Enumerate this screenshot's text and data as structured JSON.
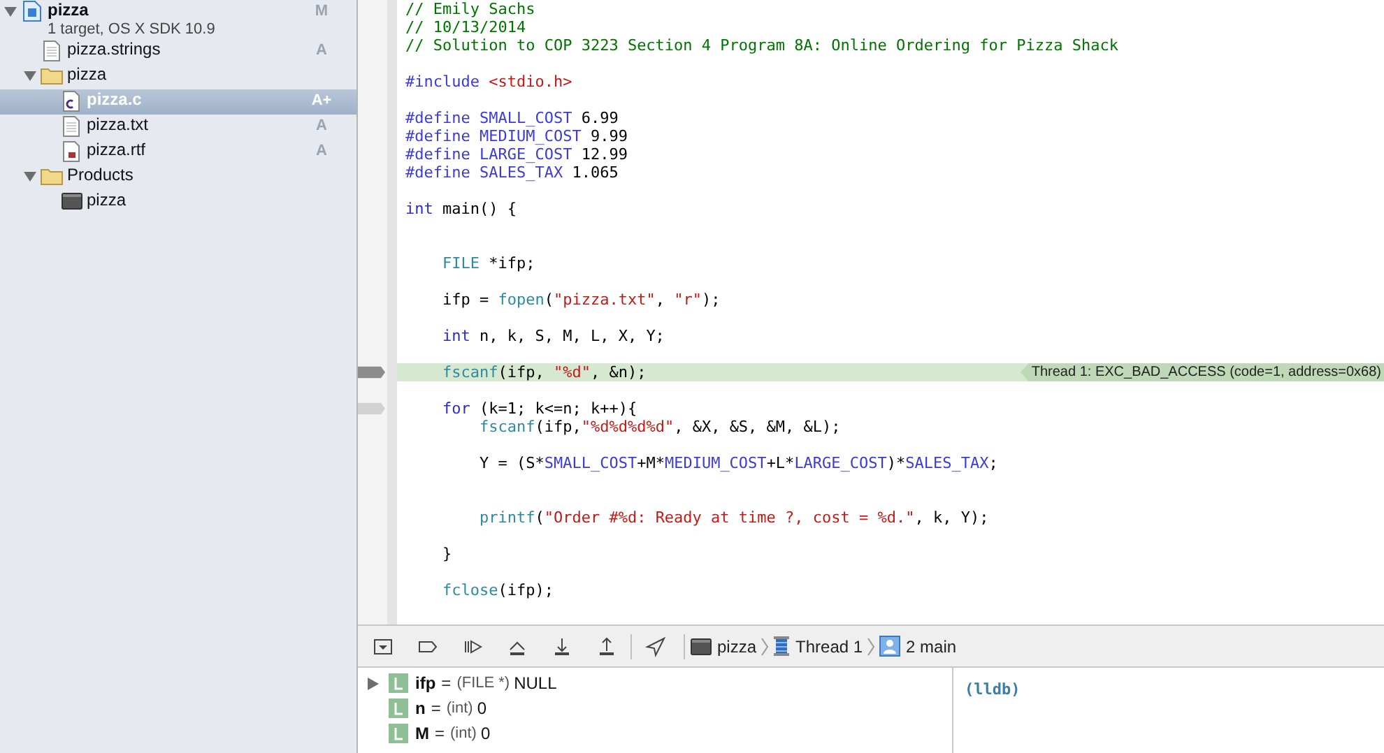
{
  "navigator": {
    "items": [
      {
        "kind": "project",
        "label": "pizza",
        "subtitle": "1 target, OS X SDK 10.9",
        "badge": "M",
        "expanded": true,
        "selected": false,
        "children": [
          {
            "kind": "strings",
            "label": "pizza.strings",
            "badge": "A",
            "selected": false
          },
          {
            "kind": "folder",
            "label": "pizza",
            "expanded": true,
            "selected": false,
            "children": [
              {
                "kind": "c",
                "label": "pizza.c",
                "badge": "A+",
                "selected": true
              },
              {
                "kind": "text",
                "label": "pizza.txt",
                "badge": "A",
                "selected": false
              },
              {
                "kind": "rtf",
                "label": "pizza.rtf",
                "badge": "A",
                "selected": false
              }
            ]
          },
          {
            "kind": "folder",
            "label": "Products",
            "expanded": true,
            "selected": false,
            "children": [
              {
                "kind": "app",
                "label": "pizza",
                "selected": false
              }
            ]
          }
        ]
      }
    ]
  },
  "editor": {
    "lines": [
      {
        "kind": "code",
        "tokens": [
          {
            "text": "// Emily Sachs",
            "kind": "comment"
          }
        ]
      },
      {
        "kind": "code",
        "tokens": [
          {
            "text": "// 10/13/2014",
            "kind": "comment"
          }
        ]
      },
      {
        "kind": "code",
        "tokens": [
          {
            "text": "// Solution to COP 3223 Section 4 Program 8A: Online Ordering for Pizza Shack",
            "kind": "comment"
          }
        ]
      },
      {
        "kind": "blank"
      },
      {
        "kind": "code",
        "tokens": [
          {
            "text": "#include ",
            "kind": "preproc"
          },
          {
            "text": "<stdio.h>",
            "kind": "string"
          }
        ]
      },
      {
        "kind": "blank"
      },
      {
        "kind": "code",
        "tokens": [
          {
            "text": "#define ",
            "kind": "preproc"
          },
          {
            "text": "SMALL_COST",
            "kind": "macro"
          },
          {
            "text": " 6.99",
            "kind": "plain"
          }
        ]
      },
      {
        "kind": "code",
        "tokens": [
          {
            "text": "#define ",
            "kind": "preproc"
          },
          {
            "text": "MEDIUM_COST",
            "kind": "macro"
          },
          {
            "text": " 9.99",
            "kind": "plain"
          }
        ]
      },
      {
        "kind": "code",
        "tokens": [
          {
            "text": "#define ",
            "kind": "preproc"
          },
          {
            "text": "LARGE_COST",
            "kind": "macro"
          },
          {
            "text": " 12.99",
            "kind": "plain"
          }
        ]
      },
      {
        "kind": "code",
        "tokens": [
          {
            "text": "#define ",
            "kind": "preproc"
          },
          {
            "text": "SALES_TAX",
            "kind": "macro"
          },
          {
            "text": " 1.065",
            "kind": "plain"
          }
        ]
      },
      {
        "kind": "blank"
      },
      {
        "kind": "code",
        "tokens": [
          {
            "text": "int",
            "kind": "keyword"
          },
          {
            "text": " main() {",
            "kind": "plain"
          }
        ]
      },
      {
        "kind": "blank"
      },
      {
        "kind": "blank"
      },
      {
        "kind": "code",
        "tokens": [
          {
            "text": "    FILE",
            "kind": "type"
          },
          {
            "text": " *ifp;",
            "kind": "plain"
          }
        ]
      },
      {
        "kind": "blank"
      },
      {
        "kind": "code",
        "tokens": [
          {
            "text": "    ifp = ",
            "kind": "plain"
          },
          {
            "text": "fopen",
            "kind": "type"
          },
          {
            "text": "(",
            "kind": "plain"
          },
          {
            "text": "\"pizza.txt\"",
            "kind": "string"
          },
          {
            "text": ", ",
            "kind": "plain"
          },
          {
            "text": "\"r\"",
            "kind": "string"
          },
          {
            "text": ");",
            "kind": "plain"
          }
        ]
      },
      {
        "kind": "blank"
      },
      {
        "kind": "code",
        "tokens": [
          {
            "text": "    int",
            "kind": "keyword"
          },
          {
            "text": " n, k, S, M, L, X, Y;",
            "kind": "plain"
          }
        ]
      },
      {
        "kind": "blank"
      },
      {
        "kind": "code",
        "highlighted": true,
        "current_line": true,
        "annotation": "Thread 1: EXC_BAD_ACCESS (code=1, address=0x68)",
        "tokens": [
          {
            "text": "    fscanf",
            "kind": "type"
          },
          {
            "text": "(ifp, ",
            "kind": "plain"
          },
          {
            "text": "\"%d\"",
            "kind": "string"
          },
          {
            "text": ", &n);",
            "kind": "plain"
          }
        ]
      },
      {
        "kind": "blank"
      },
      {
        "kind": "code",
        "frame_line": true,
        "tokens": [
          {
            "text": "    for",
            "kind": "keyword"
          },
          {
            "text": " (k=1; k<=n; k++){",
            "kind": "plain"
          }
        ]
      },
      {
        "kind": "code",
        "tokens": [
          {
            "text": "        fscanf",
            "kind": "type"
          },
          {
            "text": "(ifp,",
            "kind": "plain"
          },
          {
            "text": "\"%d%d%d%d\"",
            "kind": "string"
          },
          {
            "text": ", &X, &S, &M, &L);",
            "kind": "plain"
          }
        ]
      },
      {
        "kind": "blank"
      },
      {
        "kind": "code",
        "tokens": [
          {
            "text": "        Y = (S*",
            "kind": "plain"
          },
          {
            "text": "SMALL_COST",
            "kind": "macro"
          },
          {
            "text": "+M*",
            "kind": "plain"
          },
          {
            "text": "MEDIUM_COST",
            "kind": "macro"
          },
          {
            "text": "+L*",
            "kind": "plain"
          },
          {
            "text": "LARGE_COST",
            "kind": "macro"
          },
          {
            "text": ")*",
            "kind": "plain"
          },
          {
            "text": "SALES_TAX",
            "kind": "macro"
          },
          {
            "text": ";",
            "kind": "plain"
          }
        ]
      },
      {
        "kind": "blank"
      },
      {
        "kind": "blank"
      },
      {
        "kind": "code",
        "tokens": [
          {
            "text": "        printf",
            "kind": "type"
          },
          {
            "text": "(",
            "kind": "plain"
          },
          {
            "text": "\"Order #%d: Ready at time ?, cost = %d.\"",
            "kind": "string"
          },
          {
            "text": ", k, Y);",
            "kind": "plain"
          }
        ]
      },
      {
        "kind": "blank"
      },
      {
        "kind": "code",
        "tokens": [
          {
            "text": "    }",
            "kind": "plain"
          }
        ]
      },
      {
        "kind": "blank"
      },
      {
        "kind": "code",
        "tokens": [
          {
            "text": "    fclose",
            "kind": "type"
          },
          {
            "text": "(ifp);",
            "kind": "plain"
          }
        ]
      }
    ]
  },
  "debug_bar": {
    "breadcrumbs": [
      {
        "kind": "app",
        "label": "pizza"
      },
      {
        "kind": "thread",
        "label": "Thread 1"
      },
      {
        "kind": "frame",
        "label": "2 main"
      }
    ]
  },
  "variables": [
    {
      "name": "ifp",
      "operator": "=",
      "type": "(FILE *)",
      "value": "NULL",
      "expandable": true
    },
    {
      "name": "n",
      "operator": "=",
      "type": "(int)",
      "value": "0",
      "expandable": false
    },
    {
      "name": "M",
      "operator": "=",
      "type": "(int)",
      "value": "0",
      "expandable": false
    }
  ],
  "console": {
    "prompt": "(lldb)"
  }
}
